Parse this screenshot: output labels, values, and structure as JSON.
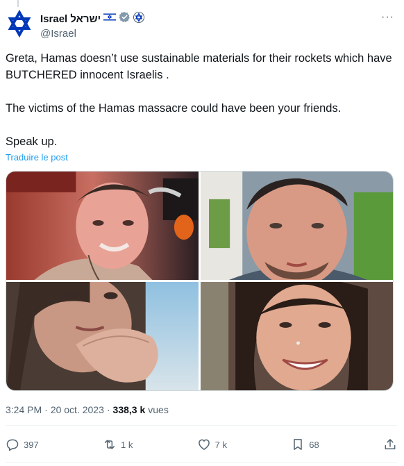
{
  "account": {
    "display_name": "Israel ישראל",
    "flag": "🇮🇱",
    "handle": "@Israel"
  },
  "menu": {
    "more_label": "···"
  },
  "tweet": {
    "paragraphs": [
      "Greta, Hamas doesn’t use sustainable materials for their rockets which have BUTCHERED innocent Israelis .",
      "The victims of the Hamas massacre could have been your friends.",
      "Speak up."
    ],
    "translate_label": "Traduire le post"
  },
  "meta": {
    "time": "3:24 PM",
    "separator": "·",
    "date": "20 oct. 2023",
    "views_count": "338,3 k",
    "views_label": "vues"
  },
  "actions": {
    "replies": "397",
    "reposts": "1 k",
    "likes": "7 k",
    "bookmarks": "68"
  },
  "colors": {
    "accent": "#1d9bf0",
    "secondary_text": "#536471",
    "israel_blue": "#0038b8"
  }
}
